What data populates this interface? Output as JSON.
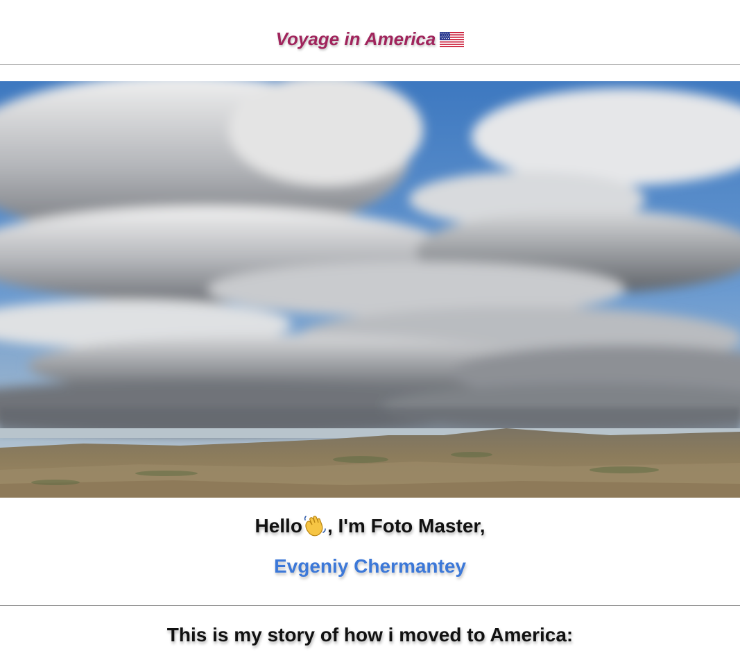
{
  "header": {
    "title": "Voyage in America",
    "flag_icon": "us-flag-icon"
  },
  "hero": {
    "image": "landscape-photo-badlands-cloudy-sky"
  },
  "intro": {
    "greeting_before": "Hello",
    "greeting_icon": "waving-hand-icon",
    "greeting_after": ", I'm Foto Master,",
    "author_name": "Evgeniy Chermantey"
  },
  "story": {
    "heading": "This is my story of how i moved to America:"
  },
  "colors": {
    "title": "#a0245c",
    "link": "#3c78d8",
    "divider": "#8a8a8a"
  }
}
